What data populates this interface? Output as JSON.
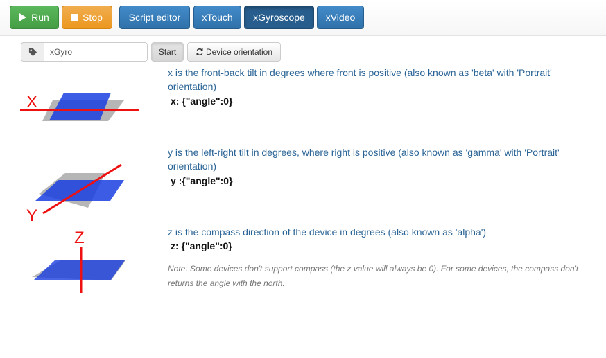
{
  "toolbar": {
    "run_label": "Run",
    "stop_label": "Stop",
    "script_editor_label": "Script editor",
    "xtouch_label": "xTouch",
    "xgyroscope_label": "xGyroscope",
    "xvideo_label": "xVideo"
  },
  "controls": {
    "name_value": "xGyro",
    "start_label": "Start",
    "orientation_label": "Device orientation"
  },
  "axes": {
    "x": {
      "letter": "X",
      "description": "x is the front-back tilt in degrees where front is positive (also known as 'beta' with 'Portrait' orientation)",
      "value": "x: {\"angle\":0}"
    },
    "y": {
      "letter": "Y",
      "description": "y is the left-right tilt in degrees, where right is positive (also known as 'gamma' with 'Portrait' orientation)",
      "value": "y :{\"angle\":0}"
    },
    "z": {
      "letter": "Z",
      "description": "z is the compass direction of the device in degrees (also known as 'alpha')",
      "value": "z: {\"angle\":0}",
      "note": "Note: Some devices don't support compass (the z value will always be 0). For some devices, the compass don't returns the angle with the north."
    }
  },
  "colors": {
    "device_blue": "#1a3fe0",
    "shadow_gray": "#a9a9a9",
    "axis_red": "#ee1111"
  }
}
